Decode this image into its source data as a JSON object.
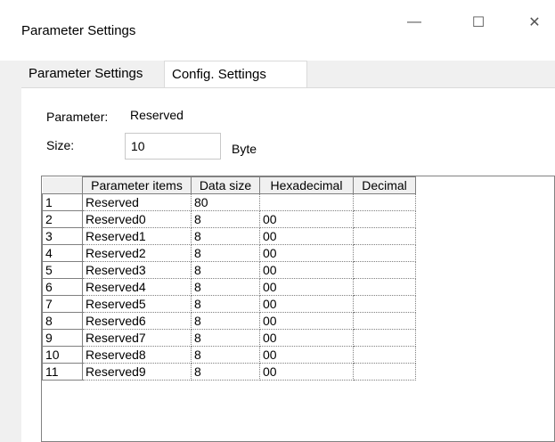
{
  "window": {
    "title": "Parameter Settings",
    "minimize_glyph": "—",
    "maximize_glyph": "☐",
    "close_glyph": "✕"
  },
  "tabs": [
    {
      "label": "Parameter Settings",
      "active": false
    },
    {
      "label": "Config. Settings",
      "active": true
    }
  ],
  "form": {
    "parameter_label": "Parameter:",
    "parameter_value": "Reserved",
    "size_label": "Size:",
    "size_value": "10",
    "size_unit": "Byte"
  },
  "table": {
    "columns": [
      "Parameter items",
      "Data size",
      "Hexadecimal",
      "Decimal"
    ],
    "rows": [
      {
        "num": "1",
        "item": "Reserved",
        "size": "80",
        "hex": "",
        "dec": ""
      },
      {
        "num": "2",
        "item": "Reserved0",
        "size": "8",
        "hex": "00",
        "dec": ""
      },
      {
        "num": "3",
        "item": "Reserved1",
        "size": "8",
        "hex": "00",
        "dec": ""
      },
      {
        "num": "4",
        "item": "Reserved2",
        "size": "8",
        "hex": "00",
        "dec": ""
      },
      {
        "num": "5",
        "item": "Reserved3",
        "size": "8",
        "hex": "00",
        "dec": ""
      },
      {
        "num": "6",
        "item": "Reserved4",
        "size": "8",
        "hex": "00",
        "dec": ""
      },
      {
        "num": "7",
        "item": "Reserved5",
        "size": "8",
        "hex": "00",
        "dec": ""
      },
      {
        "num": "8",
        "item": "Reserved6",
        "size": "8",
        "hex": "00",
        "dec": ""
      },
      {
        "num": "9",
        "item": "Reserved7",
        "size": "8",
        "hex": "00",
        "dec": ""
      },
      {
        "num": "10",
        "item": "Reserved8",
        "size": "8",
        "hex": "00",
        "dec": ""
      },
      {
        "num": "11",
        "item": "Reserved9",
        "size": "8",
        "hex": "00",
        "dec": ""
      }
    ]
  }
}
